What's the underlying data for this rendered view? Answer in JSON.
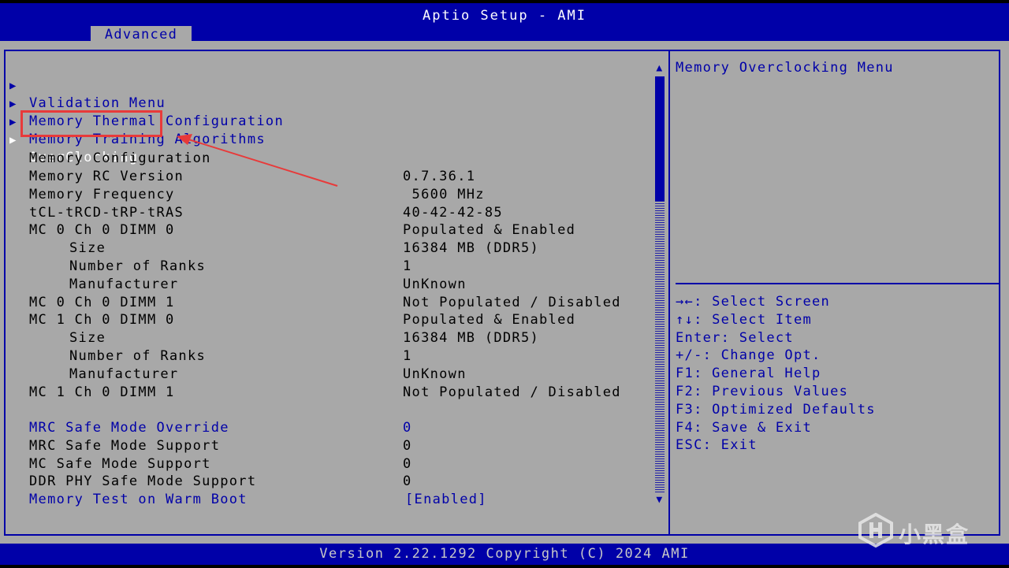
{
  "header": {
    "title": "Aptio Setup - AMI",
    "active_tab": "Advanced"
  },
  "menu": {
    "submenus": [
      {
        "label": "Validation Menu"
      },
      {
        "label": "Memory Thermal Configuration"
      },
      {
        "label": "Memory Training Algorithms"
      },
      {
        "label": "OverClocking",
        "selected": true
      }
    ],
    "section_heading": "Memory Configuration",
    "info_rows": [
      {
        "label": "Memory RC Version",
        "value": "0.7.36.1",
        "indent": 0
      },
      {
        "label": "Memory Frequency",
        "value": " 5600 MHz",
        "indent": 0
      },
      {
        "label": "tCL-tRCD-tRP-tRAS",
        "value": "40-42-42-85",
        "indent": 0
      },
      {
        "label": "MC 0 Ch 0 DIMM 0",
        "value": "Populated & Enabled",
        "indent": 0
      },
      {
        "label": "Size",
        "value": "16384 MB (DDR5)",
        "indent": 1
      },
      {
        "label": "Number of Ranks",
        "value": "1",
        "indent": 1
      },
      {
        "label": "Manufacturer",
        "value": "UnKnown",
        "indent": 1
      },
      {
        "label": "MC 0 Ch 0 DIMM 1",
        "value": "Not Populated / Disabled",
        "indent": 0
      },
      {
        "label": "MC 1 Ch 0 DIMM 0",
        "value": "Populated & Enabled",
        "indent": 0
      },
      {
        "label": "Size",
        "value": "16384 MB (DDR5)",
        "indent": 1
      },
      {
        "label": "Number of Ranks",
        "value": "1",
        "indent": 1
      },
      {
        "label": "Manufacturer",
        "value": "UnKnown",
        "indent": 1
      },
      {
        "label": "MC 1 Ch 0 DIMM 1",
        "value": "Not Populated / Disabled",
        "indent": 0
      }
    ],
    "settings_rows": [
      {
        "label": "MRC Safe Mode Override",
        "value": "0",
        "editable": true
      },
      {
        "label": "MRC Safe Mode Support",
        "value": "0",
        "editable": false
      },
      {
        "label": "MC Safe Mode Support",
        "value": "0",
        "editable": false
      },
      {
        "label": "DDR PHY Safe Mode Support",
        "value": "0",
        "editable": false
      },
      {
        "label": "Memory Test on Warm Boot",
        "value": "[Enabled]",
        "editable": true
      }
    ]
  },
  "help": {
    "description": "Memory Overclocking Menu",
    "keys": [
      "→←: Select Screen",
      "↑↓: Select Item",
      "Enter: Select",
      "+/-: Change Opt.",
      "F1: General Help",
      "F2: Previous Values",
      "F3: Optimized Defaults",
      "F4: Save & Exit",
      "ESC: Exit"
    ]
  },
  "footer": {
    "version": "Version 2.22.1292 Copyright (C) 2024 AMI"
  },
  "watermark": {
    "text": "小黑盒"
  },
  "colors": {
    "bios_blue": "#0000a8",
    "bios_gray": "#a8a8a8",
    "annotation_red": "#e83a3a"
  }
}
